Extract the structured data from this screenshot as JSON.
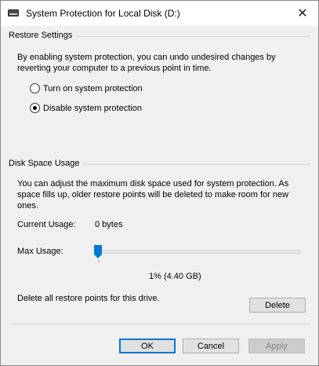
{
  "window": {
    "title": "System Protection for Local Disk (D:)",
    "close_glyph": "✕",
    "icon": "drive-icon"
  },
  "restore_settings": {
    "heading": "Restore Settings",
    "description_line1": "By enabling system protection, you can undo undesired changes by",
    "description_line2": "reverting your computer to a previous point in time.",
    "options": [
      {
        "label": "Turn on system protection",
        "checked": false
      },
      {
        "label": "Disable system protection",
        "checked": true
      }
    ]
  },
  "disk_space": {
    "heading": "Disk Space Usage",
    "description_line1": "You can adjust the maximum disk space used for system protection. As",
    "description_line2": "space fills up, older restore points will be deleted to make room for new",
    "description_line3": "ones.",
    "current_usage_label": "Current Usage:",
    "current_usage_value": "0 bytes",
    "max_usage_label": "Max Usage:",
    "max_usage_percent": 1,
    "max_usage_text": "1% (4.40 GB)",
    "delete_text": "Delete all restore points for this drive.",
    "delete_button": "Delete"
  },
  "footer": {
    "ok": "OK",
    "cancel": "Cancel",
    "apply": "Apply"
  },
  "colors": {
    "accent": "#0078d7",
    "dialog_bg": "#f0f0f0"
  }
}
